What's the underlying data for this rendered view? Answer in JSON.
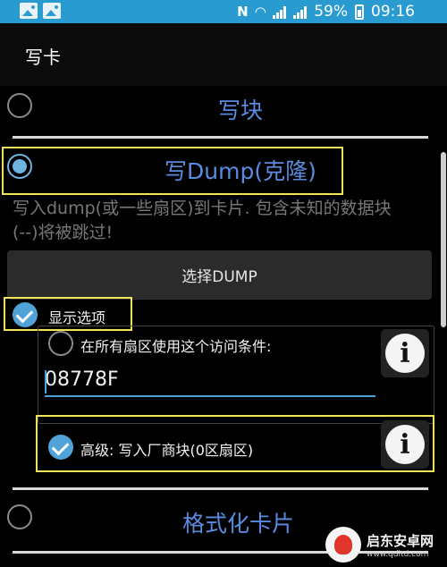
{
  "status_bar": {
    "battery": "59%",
    "time": "09:16",
    "icons": [
      "image-icon",
      "image-icon",
      "nfc-icon",
      "wifi-icon",
      "signal-icon",
      "signal-icon",
      "battery-icon"
    ]
  },
  "app_bar": {
    "title": "写卡"
  },
  "options": {
    "write_block": {
      "label": "写块",
      "selected": false
    },
    "write_dump": {
      "label": "写Dump(克隆)",
      "selected": true
    },
    "format_card": {
      "label": "格式化卡片",
      "selected": false
    }
  },
  "dump_section": {
    "description": "写入dump(或一些扇区)到卡片. 包含未知的数据块(--)将被跳过!",
    "select_button": "选择DUMP",
    "show_options": {
      "label": "显示选项",
      "checked": true
    },
    "access_condition": {
      "label": "在所有扇区使用这个访问条件:",
      "checked": false,
      "value": "08778F"
    },
    "advanced": {
      "label": "高级: 写入厂商块(0区扇区)",
      "checked": true
    }
  },
  "watermark": {
    "title": "启东安卓网",
    "url": "www.qdltd.com"
  },
  "colors": {
    "status_bar": "#2a9bd1",
    "accent": "#4fa3d8",
    "title_text": "#5a8be0",
    "highlight": "#f0e35c"
  }
}
